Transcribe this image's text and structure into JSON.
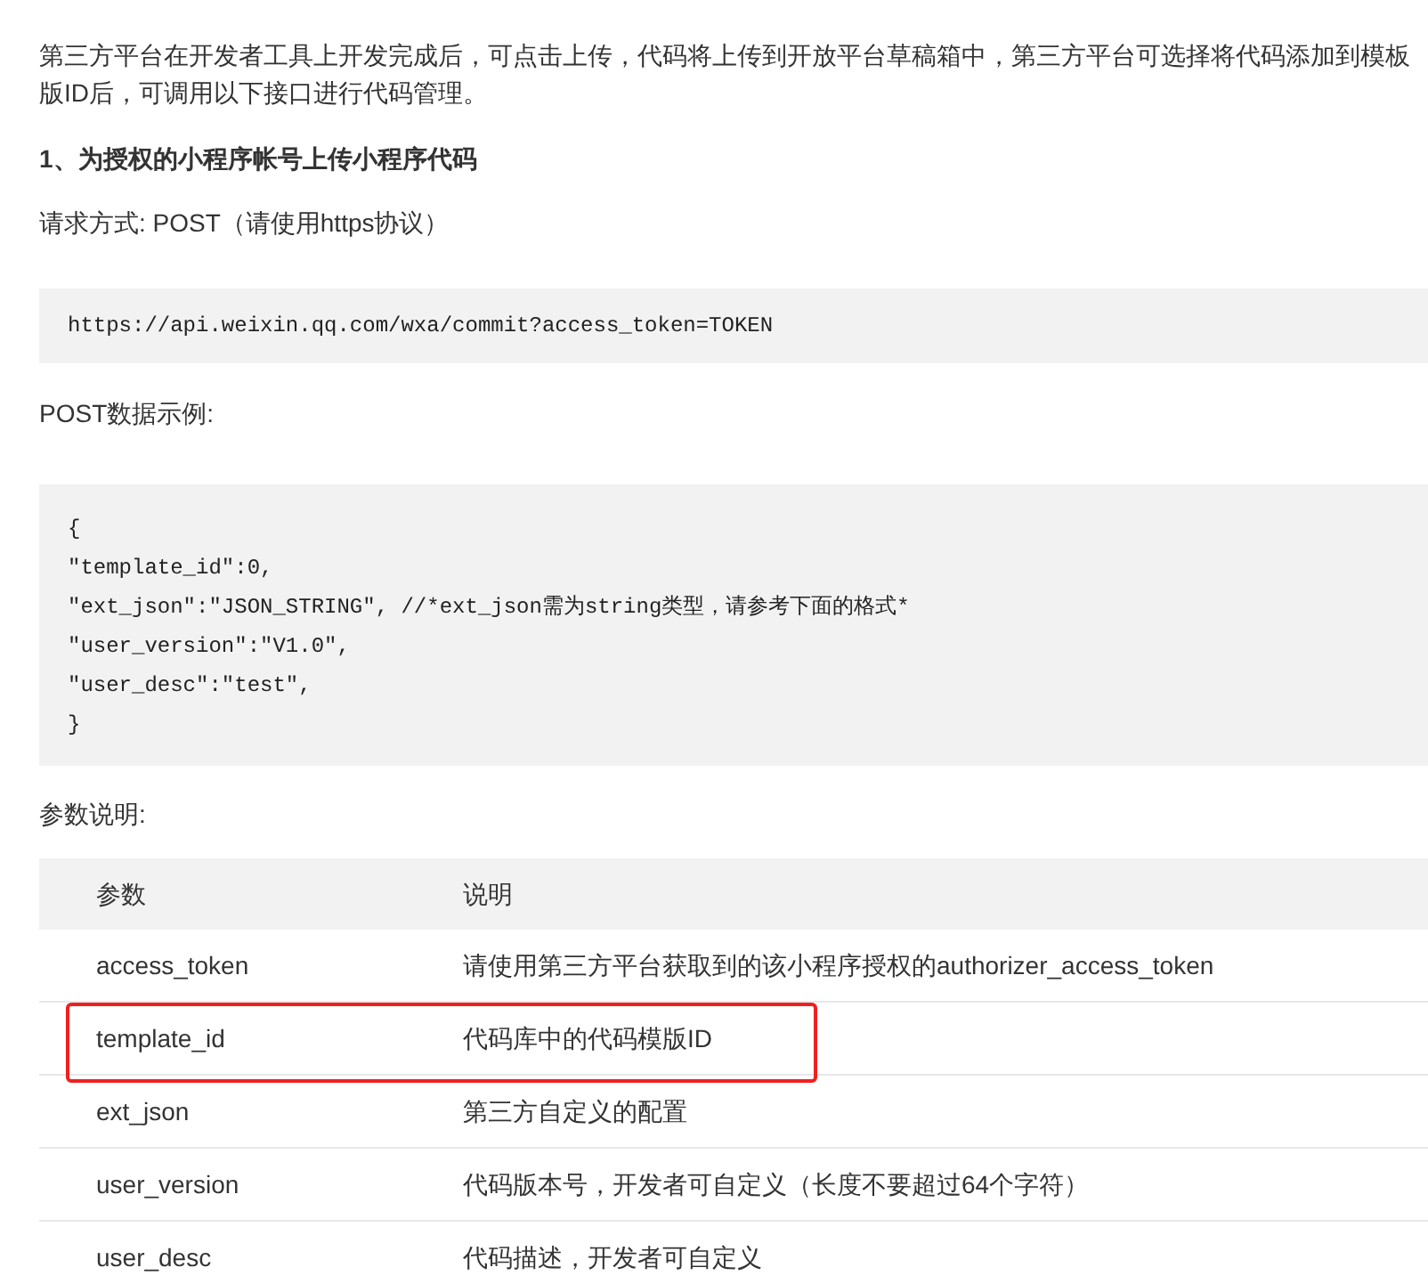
{
  "intro": {
    "lines": [
      "第三方平台在开发者工具上开发完成后，可点击上传，代码将上传到开放平台草稿箱中，第三方平台可选择将代码添加到模板",
      "版ID后，可调用以下接口进行代码管理。"
    ]
  },
  "heading": "1、为授权的小程序帐号上传小程序代码",
  "request_method": "请求方式: POST（请使用https协议）",
  "url_code": [
    "https://api.weixin.qq.com/wxa/commit?access_token=TOKEN"
  ],
  "post_label": "POST数据示例:",
  "post_code": [
    "{",
    "\"template_id\":0,",
    "\"ext_json\":\"JSON_STRING\", //*ext_json需为string类型，请参考下面的格式*",
    "\"user_version\":\"V1.0\",",
    "\"user_desc\":\"test\",",
    "}"
  ],
  "params_label": "参数说明:",
  "table": {
    "columns": [
      "参数",
      "说明"
    ],
    "rows": [
      {
        "cells": [
          "access_token",
          "请使用第三方平台获取到的该小程序授权的authorizer_access_token"
        ],
        "highlighted": false
      },
      {
        "cells": [
          "template_id",
          "代码库中的代码模版ID"
        ],
        "highlighted": true
      },
      {
        "cells": [
          "ext_json",
          "第三方自定义的配置"
        ],
        "highlighted": false
      },
      {
        "cells": [
          "user_version",
          "代码版本号，开发者可自定义（长度不要超过64个字符）"
        ],
        "highlighted": false
      },
      {
        "cells": [
          "user_desc",
          "代码描述，开发者可自定义"
        ],
        "highlighted": false
      }
    ]
  }
}
